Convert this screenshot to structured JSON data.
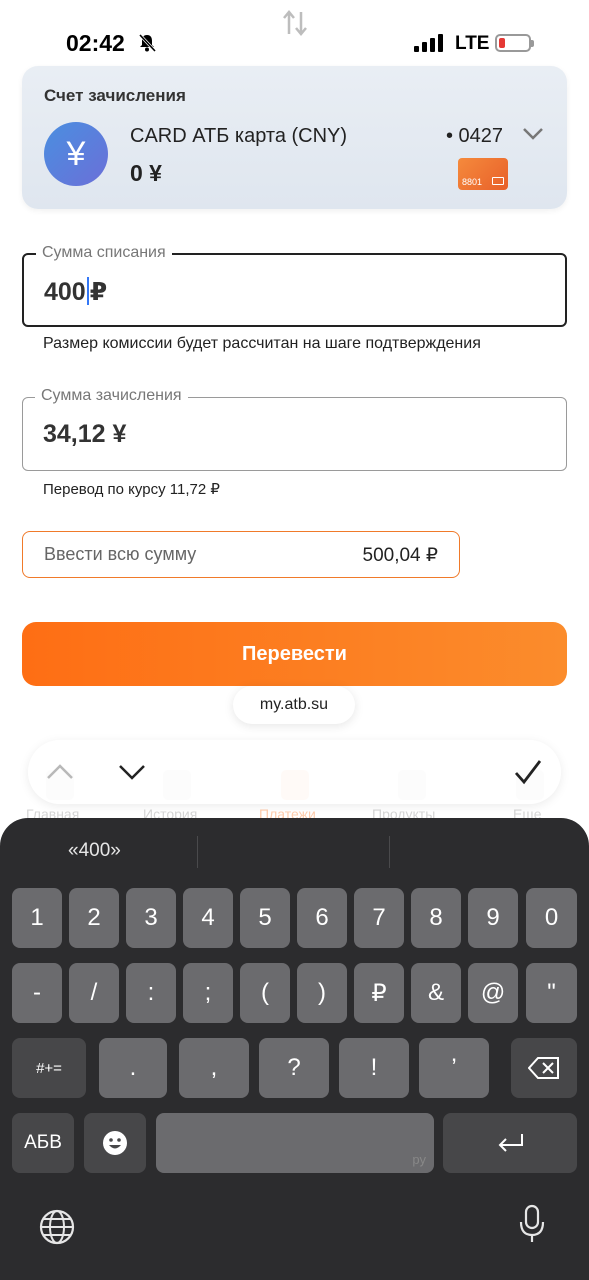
{
  "status_bar": {
    "time": "02:42",
    "network": "LTE"
  },
  "account": {
    "title": "Счет зачисления",
    "card_name": "CARD АТБ карта (CNY)",
    "balance": "0 ¥",
    "card_number": "• 0427",
    "mini_card_label": "8801",
    "currency_symbol": "¥"
  },
  "debit_field": {
    "label": "Сумма списания",
    "value_left": "400",
    "value_right": "₽"
  },
  "commission_hint": "Размер комиссии будет рассчитан на шаге подтверждения",
  "credit_field": {
    "label": "Сумма зачисления",
    "value": "34,12 ¥"
  },
  "rate_hint": "Перевод по курсу 11,72 ₽",
  "full_amount": {
    "label": "Ввести всю сумму",
    "value": "500,04 ₽"
  },
  "transfer_button": "Перевести",
  "url_pill": "my.atb.su",
  "tabbar": {
    "tabs": [
      "Главная",
      "История",
      "Платежи",
      "Продукты",
      "Еще"
    ]
  },
  "keyboard": {
    "suggestion": "«400»",
    "row1": [
      "1",
      "2",
      "3",
      "4",
      "5",
      "6",
      "7",
      "8",
      "9",
      "0"
    ],
    "row2": [
      "-",
      "/",
      ":",
      ";",
      "(",
      ")",
      "₽",
      "&",
      "@",
      "\""
    ],
    "row3_shift": "#+=",
    "row3": [
      ".",
      ",",
      "?",
      "!",
      "’"
    ],
    "abc_label": "АБВ",
    "space_lang": "ру"
  },
  "colors": {
    "accent": "#fe6e14",
    "keyboard_bg": "#2c2c2e",
    "key": "#6b6b6e"
  }
}
